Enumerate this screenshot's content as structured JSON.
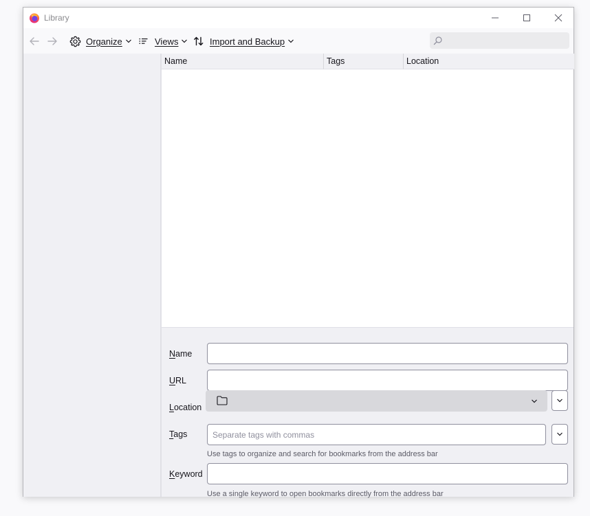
{
  "window": {
    "title": "Library"
  },
  "toolbar": {
    "back_icon": "arrow-left-icon",
    "forward_icon": "arrow-right-icon",
    "organize_label": "Organize",
    "views_label": "Views",
    "import_label": "Import and Backup",
    "search_placeholder": ""
  },
  "tree": {
    "columns": [
      {
        "label": "Name"
      },
      {
        "label": "Tags"
      },
      {
        "label": "Location"
      }
    ]
  },
  "details": {
    "name_label_ak": "N",
    "name_label_rest": "ame",
    "name_value": "",
    "url_label_ak": "U",
    "url_label_rest": "RL",
    "url_value": "",
    "location_label_ak": "L",
    "location_label_rest": "ocation",
    "location_value": "",
    "tags_label_ak": "T",
    "tags_label_rest": "ags",
    "tags_placeholder": "Separate tags with commas",
    "tags_hint": "Use tags to organize and search for bookmarks from the address bar",
    "keyword_label_ak": "K",
    "keyword_label_rest": "eyword",
    "keyword_value": "",
    "keyword_hint": "Use a single keyword to open bookmarks directly from the address bar"
  },
  "colors": {
    "accent": "#0061e0",
    "firefox_orange": "#ff7139",
    "firefox_purple": "#7542e5"
  }
}
